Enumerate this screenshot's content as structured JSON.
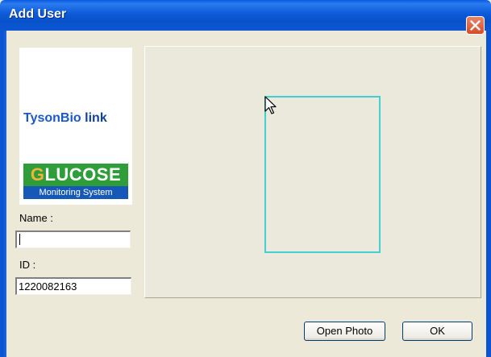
{
  "window": {
    "title": "Add User",
    "close_icon": "close-icon"
  },
  "logo": {
    "brand_left": "TysonBio",
    "brand_right": " link",
    "product_first_letter": "G",
    "product_rest": "LUCOSE",
    "product_subtitle": "Monitoring System"
  },
  "form": {
    "name_label": "Name :",
    "name_value": "",
    "id_label": "ID :",
    "id_value": "1220082163"
  },
  "photo": {
    "cursor_icon": "mouse-pointer-icon"
  },
  "buttons": {
    "open_photo": "Open Photo",
    "ok": "OK"
  },
  "colors": {
    "titlebar": "#0b55d3",
    "dialog_bg": "#ece9d8",
    "photo_frame": "#3ed1d2",
    "close_button": "#d64b26"
  }
}
